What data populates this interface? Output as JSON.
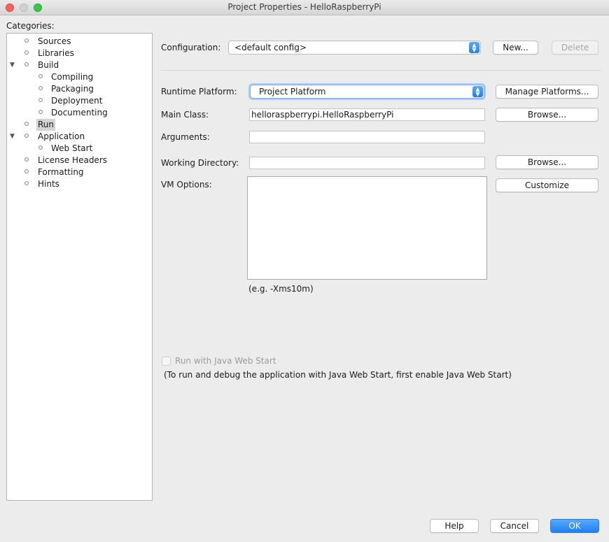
{
  "window": {
    "title": "Project Properties - HelloRaspberryPi"
  },
  "categories": {
    "label": "Categories:",
    "items": [
      {
        "label": "Sources",
        "level": 1,
        "expandable": false
      },
      {
        "label": "Libraries",
        "level": 1,
        "expandable": false
      },
      {
        "label": "Build",
        "level": 1,
        "expandable": true
      },
      {
        "label": "Compiling",
        "level": 2,
        "expandable": false
      },
      {
        "label": "Packaging",
        "level": 2,
        "expandable": false
      },
      {
        "label": "Deployment",
        "level": 2,
        "expandable": false
      },
      {
        "label": "Documenting",
        "level": 2,
        "expandable": false
      },
      {
        "label": "Run",
        "level": 1,
        "expandable": false,
        "selected": true
      },
      {
        "label": "Application",
        "level": 1,
        "expandable": true
      },
      {
        "label": "Web Start",
        "level": 2,
        "expandable": false
      },
      {
        "label": "License Headers",
        "level": 1,
        "expandable": false
      },
      {
        "label": "Formatting",
        "level": 1,
        "expandable": false
      },
      {
        "label": "Hints",
        "level": 1,
        "expandable": false
      }
    ]
  },
  "run": {
    "configuration_label": "Configuration:",
    "configuration_value": "<default config>",
    "new_label": "New...",
    "delete_label": "Delete",
    "runtime_platform_label": "Runtime Platform:",
    "runtime_platform_value": "Project Platform",
    "manage_platforms_label": "Manage Platforms...",
    "main_class_label": "Main Class:",
    "main_class_value": "helloraspberrypi.HelloRaspberryPi",
    "browse_label": "Browse...",
    "arguments_label": "Arguments:",
    "arguments_value": "",
    "working_directory_label": "Working Directory:",
    "working_directory_value": "",
    "vm_options_label": "VM Options:",
    "vm_options_value": "",
    "customize_label": "Customize",
    "vm_options_hint": "(e.g. -Xms10m)",
    "webstart_checkbox_label": "Run with Java Web Start",
    "webstart_note": "(To run and debug the application with Java Web Start, first enable Java Web Start)"
  },
  "footer": {
    "help_label": "Help",
    "cancel_label": "Cancel",
    "ok_label": "OK"
  },
  "colors": {
    "accent": "#1d7ff4",
    "close": "#fc605c",
    "maximize": "#34c84a"
  }
}
